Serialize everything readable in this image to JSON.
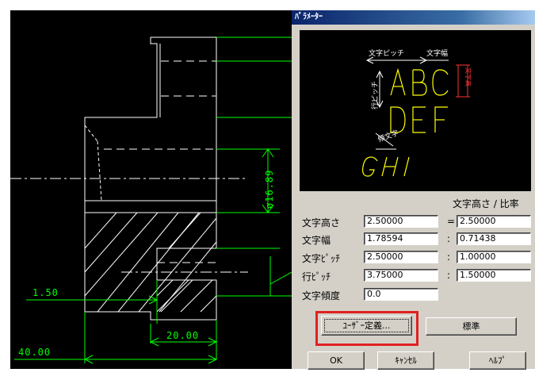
{
  "cad": {
    "dim_diameter": "ø16.89",
    "dim_150": "1.50",
    "dim_2000": "20.00",
    "dim_4000": "40.00"
  },
  "dialog": {
    "title": "ﾊﾟﾗﾒｰﾀｰ",
    "preview": {
      "label_pitch": "文字ピッチ",
      "label_width": "文字幅",
      "label_line_pitch": "行ピッチ",
      "label_slant": "傾文字",
      "label_height": "文字高",
      "row1": "ABC",
      "row2": "DEF",
      "row3": "GHI"
    },
    "header_label": "文字高さ / 比率",
    "rows": [
      {
        "label": "文字高さ",
        "value": "2.50000",
        "sep": "=",
        "ratio": "2.50000"
      },
      {
        "label": "文字幅",
        "value": "1.78594",
        "sep": ":",
        "ratio": "0.71438"
      },
      {
        "label": "文字ﾋﾟｯﾁ",
        "value": "2.50000",
        "sep": ":",
        "ratio": "1.00000"
      },
      {
        "label": "行ﾋﾟｯﾁ",
        "value": "3.75000",
        "sep": ":",
        "ratio": "1.50000"
      }
    ],
    "slant": {
      "label": "文字傾度",
      "value": "0.0"
    },
    "buttons": {
      "user_define": "ﾕｰｻﾞｰ定義...",
      "standard": "標準",
      "ok": "OK",
      "cancel": "ｷｬﾝｾﾙ",
      "help": "ﾍﾙﾌﾟ"
    },
    "colors": {
      "preview_text": "#ffff00",
      "preview_label": "#ffffff",
      "highlight": "#e02020"
    }
  }
}
